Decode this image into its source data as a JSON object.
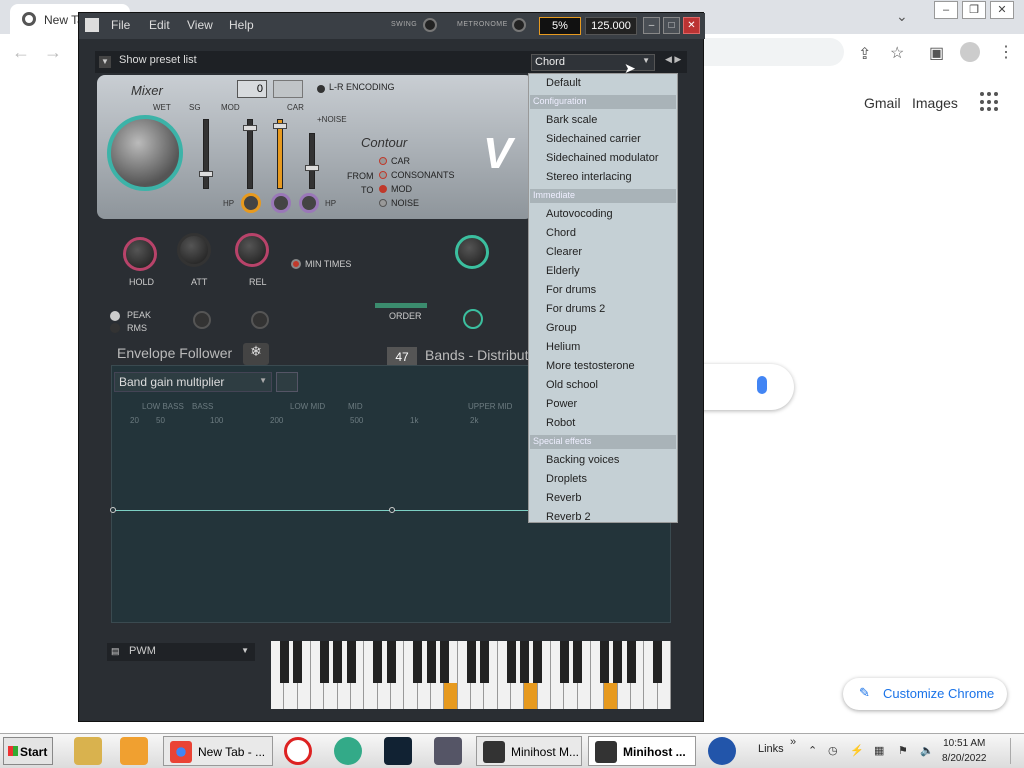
{
  "browser": {
    "tab_title": "New Ta",
    "links": {
      "gmail": "Gmail",
      "images": "Images"
    },
    "customize_label": "Customize Chrome"
  },
  "host": {
    "menu": [
      "File",
      "Edit",
      "View",
      "Help"
    ],
    "swing_label": "SWING",
    "metronome_label": "METRONOME",
    "percent": "5%",
    "tempo": "125.000",
    "show_preset_list": "Show preset list",
    "preset_selected": "Chord"
  },
  "plugin": {
    "mixer_label": "Mixer",
    "wet_label": "WET",
    "sg_label": "SG",
    "mod_label": "MOD",
    "car_label": "CAR",
    "noise_label": "+NOISE",
    "number_value": "0",
    "lr_encoding": "L-R ENCODING",
    "hp_left": "HP",
    "hp_right": "HP",
    "contour_label": "Contour",
    "from_label": "FROM",
    "to_label": "TO",
    "contour_options": [
      "CAR",
      "CONSONANTS",
      "MOD",
      "NOISE"
    ],
    "hold_label": "HOLD",
    "att_label": "ATT",
    "rel_label": "REL",
    "min_times_label": "MIN TIMES",
    "peak_label": "PEAK",
    "rms_label": "RMS",
    "order_label": "ORDER",
    "envelope_follower": "Envelope Follower",
    "bands_count": "47",
    "bands_label": "Bands - Distributi",
    "graph_select": "Band gain multiplier",
    "freq_band_labels": [
      "LOW BASS",
      "BASS",
      "LOW MID",
      "MID",
      "UPPER MID"
    ],
    "freq_tick_labels": [
      "20",
      "50",
      "100",
      "200",
      "500",
      "1k",
      "2k"
    ],
    "pwm_label": "PWM"
  },
  "dropdown": {
    "default": "Default",
    "sections": [
      {
        "header": "Configuration",
        "items": [
          "Bark scale",
          "Sidechained carrier",
          "Sidechained modulator",
          "Stereo interlacing"
        ]
      },
      {
        "header": "Immediate",
        "items": [
          "Autovocoding",
          "Chord",
          "Clearer",
          "Elderly",
          "For drums",
          "For drums 2",
          "Group",
          "Helium",
          "More testosterone",
          "Old school",
          "Power",
          "Robot"
        ]
      },
      {
        "header": "Special effects",
        "items": [
          "Backing voices",
          "Droplets",
          "Reverb",
          "Reverb 2"
        ]
      }
    ]
  },
  "taskbar": {
    "start_label": "Start",
    "chrome_task": "New Tab - ...",
    "minihost1": "Minihost M...",
    "minihost2": "Minihost ...",
    "links": "Links",
    "time": "10:51 AM",
    "date": "8/20/2022"
  },
  "colors": {
    "accent_orange": "#e79a1f",
    "teal": "#3cb3a8",
    "chrome_blue": "#1a73e8"
  }
}
